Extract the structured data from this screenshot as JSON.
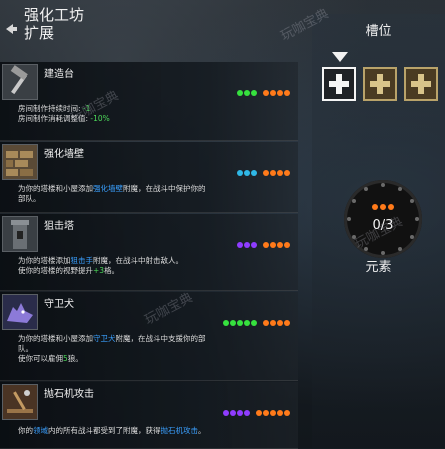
{
  "header": {
    "title": "强化工坊",
    "subtitle": "扩展"
  },
  "watermark": "玩咖宝典",
  "upgrades": [
    {
      "name": "建造台",
      "dots": [
        [
          "#36e13e",
          "#36e13e",
          "#36e13e"
        ],
        [
          "#ff7a1a",
          "#ff7a1a",
          "#ff7a1a",
          "#ff7a1a"
        ]
      ],
      "desc": [
        [
          {
            "t": "房间制作持续时间: "
          },
          {
            "t": "-1",
            "c": "g"
          }
        ],
        [
          {
            "t": "房间制作消耗调整值: "
          },
          {
            "t": "-10%",
            "c": "g"
          }
        ]
      ]
    },
    {
      "name": "强化墙壁",
      "dots": [
        [
          "#2fb7e6",
          "#2fb7e6",
          "#2fb7e6"
        ],
        [
          "#ff7a1a",
          "#ff7a1a",
          "#ff7a1a",
          "#ff7a1a"
        ]
      ],
      "desc": [
        [
          {
            "t": "为你的塔楼和小屋添加"
          },
          {
            "t": "强化墙壁",
            "c": "b"
          },
          {
            "t": "附魔，在战斗中保护你的"
          }
        ],
        [
          {
            "t": "部队。"
          }
        ]
      ]
    },
    {
      "name": "狙击塔",
      "dots": [
        [
          "#8f3cff",
          "#8f3cff",
          "#8f3cff"
        ],
        [
          "#ff7a1a",
          "#ff7a1a",
          "#ff7a1a",
          "#ff7a1a"
        ]
      ],
      "desc": [
        [
          {
            "t": "为你的塔楼添加"
          },
          {
            "t": "狙击手",
            "c": "b"
          },
          {
            "t": "附魔，在战斗中射击敌人。"
          }
        ],
        [
          {
            "t": "使你的塔楼的视野提升"
          },
          {
            "t": "+3",
            "c": "g"
          },
          {
            "t": "格。"
          }
        ]
      ]
    },
    {
      "name": "守卫犬",
      "dots": [
        [
          "#36e13e",
          "#36e13e",
          "#36e13e",
          "#36e13e",
          "#36e13e"
        ],
        [
          "#ff7a1a",
          "#ff7a1a",
          "#ff7a1a",
          "#ff7a1a"
        ]
      ],
      "desc": [
        [
          {
            "t": "为你的塔楼和小屋添加"
          },
          {
            "t": "守卫犬",
            "c": "b"
          },
          {
            "t": "附魔，在战斗中支援你的部"
          }
        ],
        [
          {
            "t": "队。"
          }
        ],
        [
          {
            "t": "使你可以雇佣"
          },
          {
            "t": "5",
            "c": "g"
          },
          {
            "t": "狼。"
          }
        ]
      ]
    },
    {
      "name": "抛石机攻击",
      "dots": [
        [
          "#8f3cff",
          "#8f3cff",
          "#8f3cff",
          "#8f3cff"
        ],
        [
          "#ff7a1a",
          "#ff7a1a",
          "#ff7a1a",
          "#ff7a1a",
          "#ff7a1a"
        ]
      ],
      "desc": [
        [
          {
            "t": "你的"
          },
          {
            "t": "领域",
            "c": "b"
          },
          {
            "t": "内的所有战斗都受到了附魔，获得"
          },
          {
            "t": "抛石机攻击",
            "c": "b"
          },
          {
            "t": "。"
          }
        ]
      ]
    }
  ],
  "slots": {
    "label": "槽位",
    "count": "0/3",
    "element_label": "元素"
  },
  "colors": {
    "slot_border": "#b9a36a",
    "slot_fill": "#4a3b22",
    "active_border": "#f5f5f5"
  }
}
